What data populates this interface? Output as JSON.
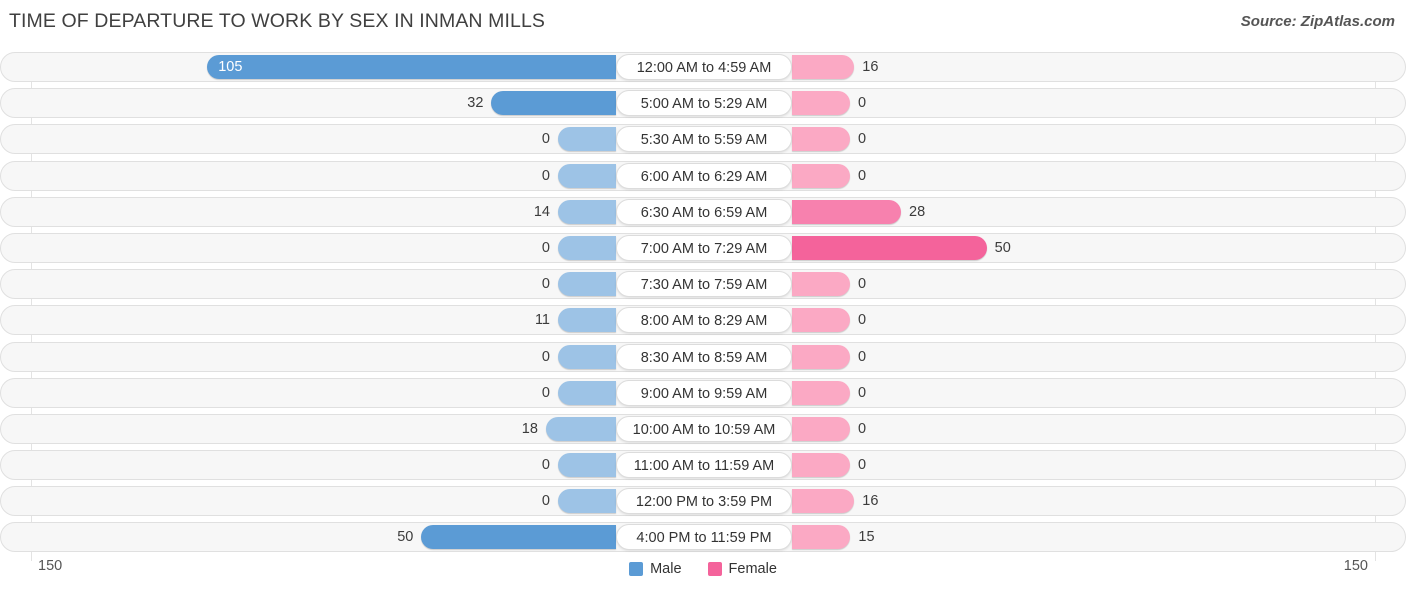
{
  "header": {
    "title": "TIME OF DEPARTURE TO WORK BY SEX IN INMAN MILLS",
    "source": "Source: ZipAtlas.com"
  },
  "axis": {
    "left_end": "150",
    "right_end": "150"
  },
  "legend": {
    "items": [
      {
        "label": "Male",
        "color": "#5b9bd5"
      },
      {
        "label": "Female",
        "color": "#f4639b"
      }
    ]
  },
  "chart_data": {
    "type": "bar",
    "title": "TIME OF DEPARTURE TO WORK BY SEX IN INMAN MILLS",
    "subtitle": "Source: ZipAtlas.com",
    "orientation": "horizontal-diverging",
    "xlabel": "",
    "ylabel": "",
    "xlim": [
      150,
      150
    ],
    "axis_left_max": 150,
    "axis_right_max": 150,
    "grid": false,
    "legend_position": "bottom-center",
    "categories": [
      "12:00 AM to 4:59 AM",
      "5:00 AM to 5:29 AM",
      "5:30 AM to 5:59 AM",
      "6:00 AM to 6:29 AM",
      "6:30 AM to 6:59 AM",
      "7:00 AM to 7:29 AM",
      "7:30 AM to 7:59 AM",
      "8:00 AM to 8:29 AM",
      "8:30 AM to 8:59 AM",
      "9:00 AM to 9:59 AM",
      "10:00 AM to 10:59 AM",
      "11:00 AM to 11:59 AM",
      "12:00 PM to 3:59 PM",
      "4:00 PM to 11:59 PM"
    ],
    "series": [
      {
        "name": "Male",
        "color": "#5b9bd5",
        "values": [
          105,
          32,
          0,
          0,
          14,
          0,
          0,
          11,
          0,
          0,
          18,
          0,
          0,
          50
        ]
      },
      {
        "name": "Female",
        "color": "#f4639b",
        "values": [
          16,
          0,
          0,
          0,
          28,
          50,
          0,
          0,
          0,
          0,
          0,
          0,
          16,
          15
        ]
      }
    ]
  }
}
